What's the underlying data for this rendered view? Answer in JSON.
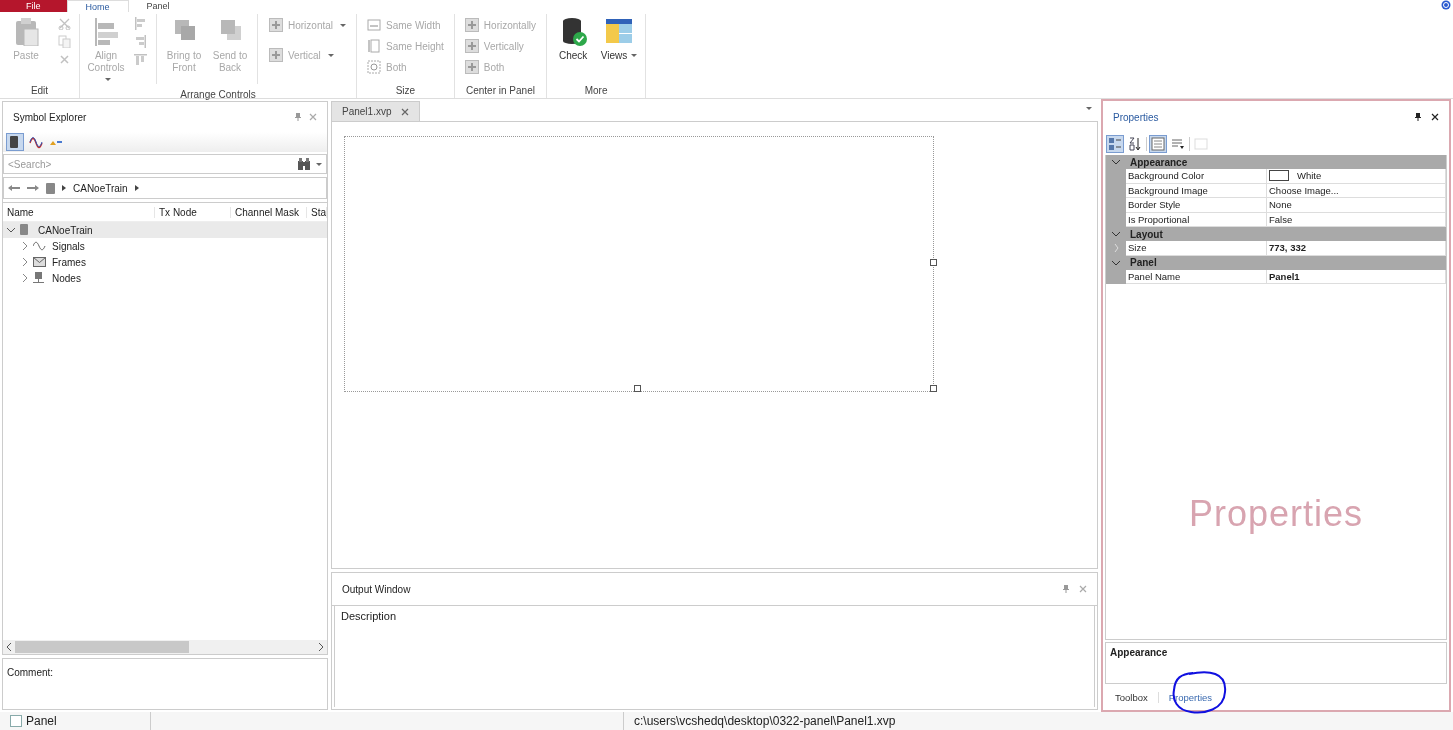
{
  "ribbon": {
    "tabs": [
      {
        "label": "File",
        "kind": "file",
        "selected": false
      },
      {
        "label": "Home",
        "kind": "tab",
        "selected": true
      },
      {
        "label": "Panel",
        "kind": "tab",
        "selected": false
      }
    ],
    "groups": [
      {
        "label": "Edit",
        "buttons": [
          {
            "kind": "large",
            "label": "Paste",
            "disabled": true,
            "dropdown": false
          },
          {
            "kind": "icon",
            "disabled": true
          },
          {
            "kind": "icon",
            "disabled": true
          },
          {
            "kind": "icon",
            "disabled": true
          }
        ]
      },
      {
        "label": "Arrange Controls",
        "buttons": [
          {
            "kind": "large",
            "label": "Align Controls",
            "disabled": true,
            "dropdown": true
          },
          {
            "kind": "icon",
            "disabled": true
          },
          {
            "kind": "icon",
            "disabled": true
          },
          {
            "kind": "icon",
            "disabled": true
          },
          {
            "kind": "large",
            "label": "Bring to Front",
            "disabled": true,
            "dropdown": false
          },
          {
            "kind": "large",
            "label": "Send to Back",
            "disabled": true,
            "dropdown": false
          },
          {
            "kind": "small",
            "label": "Horizontal",
            "disabled": true,
            "dropdown": true
          },
          {
            "kind": "small",
            "label": "Vertical",
            "disabled": true,
            "dropdown": true
          }
        ]
      },
      {
        "label": "Size",
        "buttons": [
          {
            "kind": "small",
            "label": "Same Width",
            "disabled": true,
            "dropdown": false
          },
          {
            "kind": "small",
            "label": "Same Height",
            "disabled": true,
            "dropdown": false
          },
          {
            "kind": "small",
            "label": "Both",
            "disabled": true,
            "dropdown": false
          }
        ]
      },
      {
        "label": "Center in Panel",
        "buttons": [
          {
            "kind": "small",
            "label": "Horizontally",
            "disabled": true,
            "dropdown": false
          },
          {
            "kind": "small",
            "label": "Vertically",
            "disabled": true,
            "dropdown": false
          },
          {
            "kind": "small",
            "label": "Both",
            "disabled": true,
            "dropdown": false
          }
        ]
      },
      {
        "label": "More",
        "buttons": [
          {
            "kind": "large",
            "label": "Check",
            "disabled": false,
            "dropdown": false
          },
          {
            "kind": "large",
            "label": "Views",
            "disabled": false,
            "dropdown": true
          }
        ]
      }
    ]
  },
  "symbol_explorer": {
    "title": "Symbol Explorer",
    "toolbar": [
      {
        "selected": true
      },
      {
        "selected": false
      },
      {
        "selected": false
      }
    ],
    "search": {
      "placeholder": "<Search>"
    },
    "breadcrumb": [
      "CANoeTrain"
    ],
    "columns": [
      "Name",
      "Tx Node",
      "Channel Mask",
      "Sta"
    ],
    "tree": [
      {
        "label": "CANoeTrain",
        "expanded": true,
        "selected": true,
        "children": [
          {
            "label": "Signals",
            "expanded": false,
            "selected": false
          },
          {
            "label": "Frames",
            "expanded": false,
            "selected": false
          },
          {
            "label": "Nodes",
            "expanded": false,
            "selected": false
          }
        ]
      }
    ],
    "comment_label": "Comment:"
  },
  "editor": {
    "tabs": [
      {
        "label": "Panel1.xvp",
        "selected": true
      }
    ]
  },
  "output_window": {
    "title": "Output Window",
    "columns": [
      "Description"
    ]
  },
  "properties": {
    "title": "Properties",
    "toolbar": [
      {
        "selected": true,
        "disabled": false
      },
      {
        "selected": false,
        "disabled": false
      },
      {
        "selected": true,
        "disabled": false
      },
      {
        "selected": false,
        "disabled": false
      },
      {
        "selected": false,
        "disabled": true
      }
    ],
    "categories": [
      {
        "name": "Appearance",
        "expanded": true,
        "items": [
          {
            "name": "Background Color",
            "value": "White",
            "bold": false,
            "color": "#ffffff",
            "expandable": false
          },
          {
            "name": "Background Image",
            "value": "Choose Image...",
            "bold": false,
            "expandable": false
          },
          {
            "name": "Border Style",
            "value": "None",
            "bold": false,
            "expandable": false
          },
          {
            "name": "Is Proportional",
            "value": "False",
            "bold": false,
            "expandable": false
          }
        ]
      },
      {
        "name": "Layout",
        "expanded": true,
        "items": [
          {
            "name": "Size",
            "value": "773, 332",
            "bold": true,
            "expandable": true
          }
        ]
      },
      {
        "name": "Panel",
        "expanded": true,
        "items": [
          {
            "name": "Panel Name",
            "value": "Panel1",
            "bold": true,
            "expandable": false
          }
        ]
      }
    ],
    "description_title": "Appearance",
    "bottom_tabs": [
      {
        "label": "Toolbox",
        "selected": false
      },
      {
        "label": "Properties",
        "selected": true
      }
    ],
    "overlay_label": "Properties"
  },
  "status_bar": {
    "checkbox": {
      "label": "Panel",
      "checked": false
    },
    "path": "c:\\users\\vcshedq\\desktop\\0322-panel\\Panel1.xvp"
  }
}
